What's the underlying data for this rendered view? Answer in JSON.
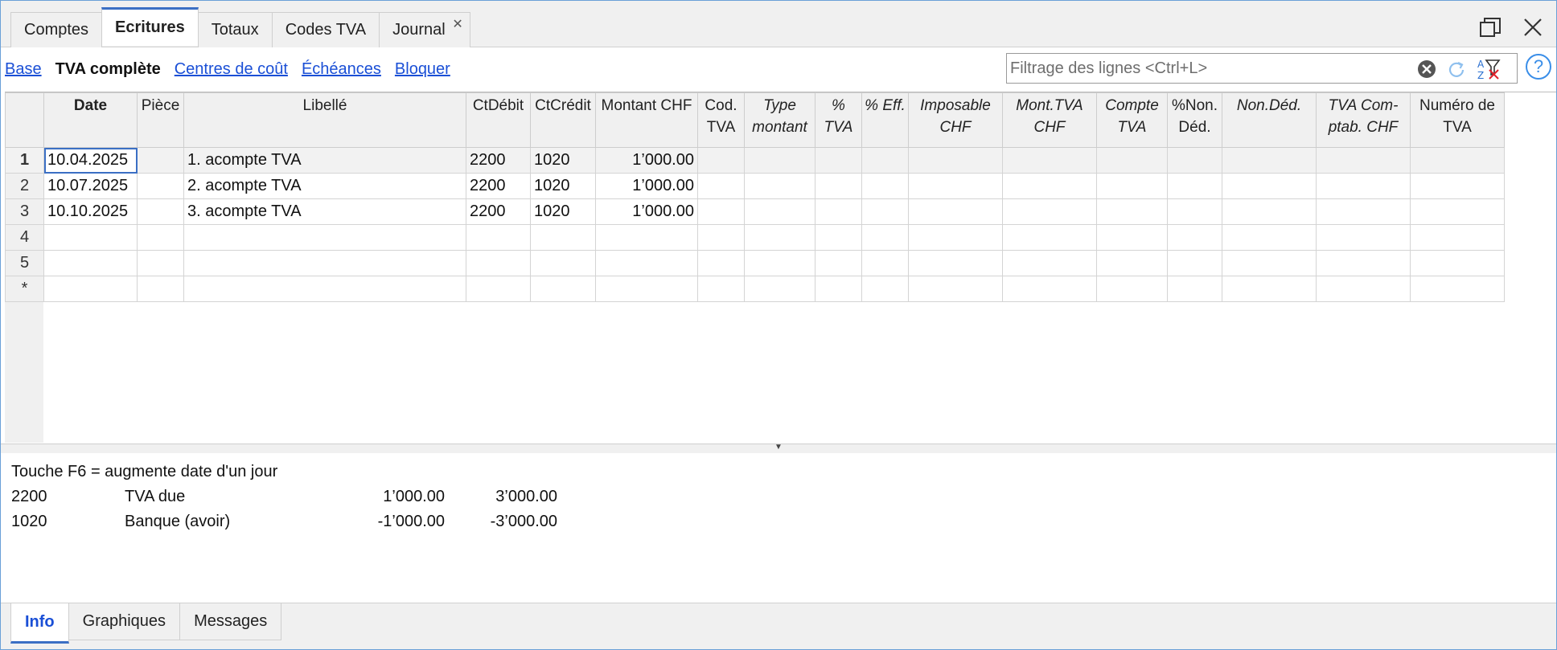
{
  "tabs": [
    {
      "label": "Comptes"
    },
    {
      "label": "Ecritures"
    },
    {
      "label": "Totaux"
    },
    {
      "label": "Codes TVA"
    },
    {
      "label": "Journal"
    }
  ],
  "active_tab": "Ecritures",
  "views": {
    "base": "Base",
    "tva_complete": "TVA complète",
    "centres": "Centres de coût",
    "echeances": "Échéances",
    "bloquer": "Bloquer"
  },
  "filter": {
    "placeholder": "Filtrage des lignes <Ctrl+L>",
    "value": ""
  },
  "icons": {
    "tab_close": "close-icon",
    "restore": "restore-window-icon",
    "close_window": "close-window-icon",
    "clear_filter": "clear-circle-icon",
    "refresh": "refresh-icon",
    "sort_filter": "sort-filter-icon",
    "help": "help-icon"
  },
  "columns": {
    "date": "Date",
    "piece": "Pièce",
    "libelle": "Libellé",
    "ctdebit": "CtDébit",
    "ctcredit": "CtCrédit",
    "montant": "Montant CHF",
    "codtva_1": "Cod.",
    "codtva_2": "TVA",
    "type_1": "Type",
    "type_2": "montant",
    "pcttva_1": "%",
    "pcttva_2": "TVA",
    "pcteff": "% Eff.",
    "imposable_1": "Imposable",
    "imposable_2": "CHF",
    "monttva_1": "Mont.TVA",
    "monttva_2": "CHF",
    "comptetva_1": "Compte",
    "comptetva_2": "TVA",
    "pctnon_1": "%Non.",
    "pctnon_2": "Déd.",
    "nonded": "Non.Déd.",
    "tvacomptab_1": "TVA Com-",
    "tvacomptab_2": "ptab. CHF",
    "numero_1": "Numéro de",
    "numero_2": "TVA"
  },
  "rows": [
    {
      "num": "1",
      "date": "10.04.2025",
      "piece": "",
      "libelle": "1. acompte TVA",
      "debit": "2200",
      "credit": "1020",
      "montant": "1’000.00"
    },
    {
      "num": "2",
      "date": "10.07.2025",
      "piece": "",
      "libelle": "2. acompte TVA",
      "debit": "2200",
      "credit": "1020",
      "montant": "1’000.00"
    },
    {
      "num": "3",
      "date": "10.10.2025",
      "piece": "",
      "libelle": "3. acompte TVA",
      "debit": "2200",
      "credit": "1020",
      "montant": "1’000.00"
    },
    {
      "num": "4",
      "date": "",
      "piece": "",
      "libelle": "",
      "debit": "",
      "credit": "",
      "montant": ""
    },
    {
      "num": "5",
      "date": "",
      "piece": "",
      "libelle": "",
      "debit": "",
      "credit": "",
      "montant": ""
    },
    {
      "num": "*",
      "date": "",
      "piece": "",
      "libelle": "",
      "debit": "",
      "credit": "",
      "montant": ""
    }
  ],
  "info": {
    "hint": "Touche F6 = augmente date d'un jour",
    "lines": [
      {
        "account": "2200",
        "name": "TVA due",
        "amount": "1’000.00",
        "total": "3’000.00"
      },
      {
        "account": "1020",
        "name": "Banque (avoir)",
        "amount": "-1’000.00",
        "total": "-3’000.00"
      }
    ]
  },
  "bottom_tabs": [
    {
      "label": "Info"
    },
    {
      "label": "Graphiques"
    },
    {
      "label": "Messages"
    }
  ],
  "colors": {
    "accent": "#3b6fc4",
    "link": "#1a4fd6",
    "negative": "#e0202a"
  }
}
